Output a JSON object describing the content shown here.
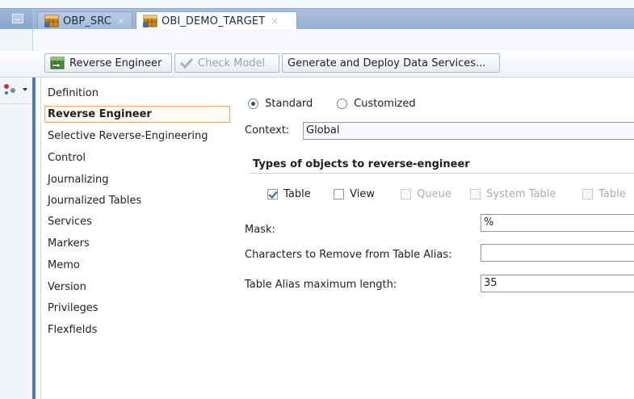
{
  "tabs": [
    {
      "label": "OBP_SRC",
      "close": "×",
      "active": false
    },
    {
      "label": "OBI_DEMO_TARGET",
      "close": "×",
      "active": true
    }
  ],
  "toolbar": {
    "reverse_engineer": "Reverse Engineer",
    "check_model": "Check Model",
    "generate_deploy": "Generate and Deploy Data Services..."
  },
  "nav": {
    "items": [
      "Definition",
      "Reverse Engineer",
      "Selective Reverse-Engineering",
      "Control",
      "Journalizing",
      "Journalized Tables",
      "Services",
      "Markers",
      "Memo",
      "Version",
      "Privileges",
      "Flexfields"
    ],
    "selected_index": 1
  },
  "form": {
    "mode_standard": "Standard",
    "mode_customized": "Customized",
    "mode_selected": "Standard",
    "context_label": "Context:",
    "context_value": "Global",
    "types_heading": "Types of objects to reverse-engineer",
    "types": [
      {
        "label": "Table",
        "checked": true,
        "enabled": true
      },
      {
        "label": "View",
        "checked": false,
        "enabled": true
      },
      {
        "label": "Queue",
        "checked": false,
        "enabled": false
      },
      {
        "label": "System Table",
        "checked": false,
        "enabled": false
      },
      {
        "label": "Table",
        "checked": false,
        "enabled": false
      }
    ],
    "mask_label": "Mask:",
    "mask_value": "%",
    "chars_remove_label": "Characters to Remove from Table Alias:",
    "chars_remove_value": "",
    "alias_max_label": "Table Alias maximum length:",
    "alias_max_value": "35"
  },
  "colors": {
    "tabbar": "#a9c0dc",
    "accent": "#4f79ad",
    "selection_border": "#f2a15f"
  },
  "icons": [
    "minimize-icon",
    "database-model-icon",
    "reverse-engineer-icon",
    "check-model-icon",
    "tool-icon"
  ]
}
